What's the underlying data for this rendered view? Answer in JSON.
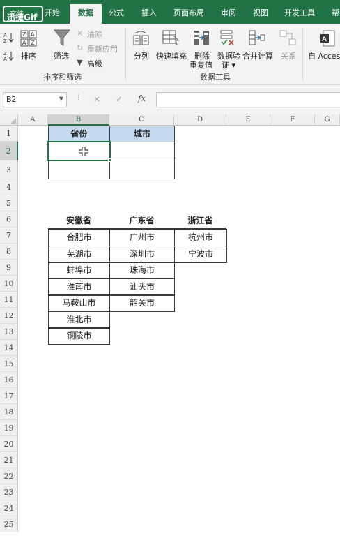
{
  "ribbon_tabs": [
    "文件",
    "开始",
    "数据",
    "公式",
    "插入",
    "页面布局",
    "审阅",
    "视图",
    "开发工具",
    "帮"
  ],
  "active_tab": "数据",
  "watermark": "迅捷Gif",
  "ribbon": {
    "sort_filter": {
      "sort": "排序",
      "filter": "筛选",
      "clear": "清除",
      "reapply": "重新应用",
      "advanced": "高级",
      "group_label": "排序和筛选"
    },
    "data_tools": {
      "split": "分列",
      "flash_fill": "快速填充",
      "remove_dup_line1": "删除",
      "remove_dup_line2": "重复值",
      "validation_line1": "数据验",
      "validation_line2": "证 ▾",
      "consolidate": "合并计算",
      "relations": "关系",
      "group_label": "数据工具"
    },
    "external": {
      "access": "自 Access"
    }
  },
  "formula_bar": {
    "name_box": "B2",
    "cancel": "×",
    "confirm": "✓",
    "fx": "fx",
    "value": ""
  },
  "columns": [
    "A",
    "B",
    "C",
    "D",
    "E",
    "F",
    "G"
  ],
  "selected_column": "B",
  "rows": [
    "1",
    "2",
    "3",
    "4",
    "5",
    "6",
    "7",
    "8",
    "9",
    "10",
    "11",
    "12",
    "13",
    "14",
    "15",
    "16",
    "17",
    "18",
    "19",
    "20",
    "21",
    "22",
    "23",
    "24",
    "25"
  ],
  "selected_row": "2",
  "table1": {
    "headers": [
      "省份",
      "城市"
    ]
  },
  "table2": {
    "headers": [
      "安徽省",
      "广东省",
      "浙江省"
    ],
    "anhui": [
      "合肥市",
      "芜湖市",
      "蚌埠市",
      "淮南市",
      "马鞍山市",
      "淮北市",
      "铜陵市"
    ],
    "guangdong": [
      "广州市",
      "深圳市",
      "珠海市",
      "汕头市",
      "韶关市"
    ],
    "zhejiang": [
      "杭州市",
      "宁波市"
    ]
  }
}
